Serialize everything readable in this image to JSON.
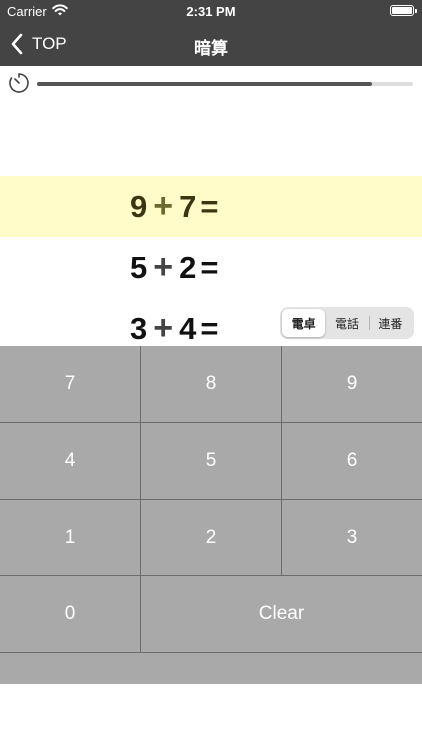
{
  "status_bar": {
    "carrier": "Carrier",
    "time": "2:31 PM"
  },
  "nav": {
    "back_label": "TOP",
    "title": "暗算"
  },
  "timer": {
    "progress": 0.89
  },
  "problems": [
    {
      "a": "9",
      "op": "+",
      "b": "7",
      "eq": "="
    },
    {
      "a": "5",
      "op": "+",
      "b": "2",
      "eq": "="
    },
    {
      "a": "3",
      "op": "+",
      "b": "4",
      "eq": "="
    }
  ],
  "layout_selector": {
    "options": [
      "電卓",
      "電話",
      "連番"
    ],
    "selected": "電卓"
  },
  "keypad": {
    "keys": [
      "7",
      "8",
      "9",
      "4",
      "5",
      "6",
      "1",
      "2",
      "3",
      "0"
    ],
    "clear_label": "Clear"
  },
  "colors": {
    "bar_background": "#444444",
    "highlight_row": "#fffcc9",
    "keypad_background": "#a9a9a9"
  },
  "icons": {
    "back": "chevron-left-icon",
    "timer": "timer-icon",
    "wifi": "wifi-icon",
    "battery": "battery-icon"
  }
}
